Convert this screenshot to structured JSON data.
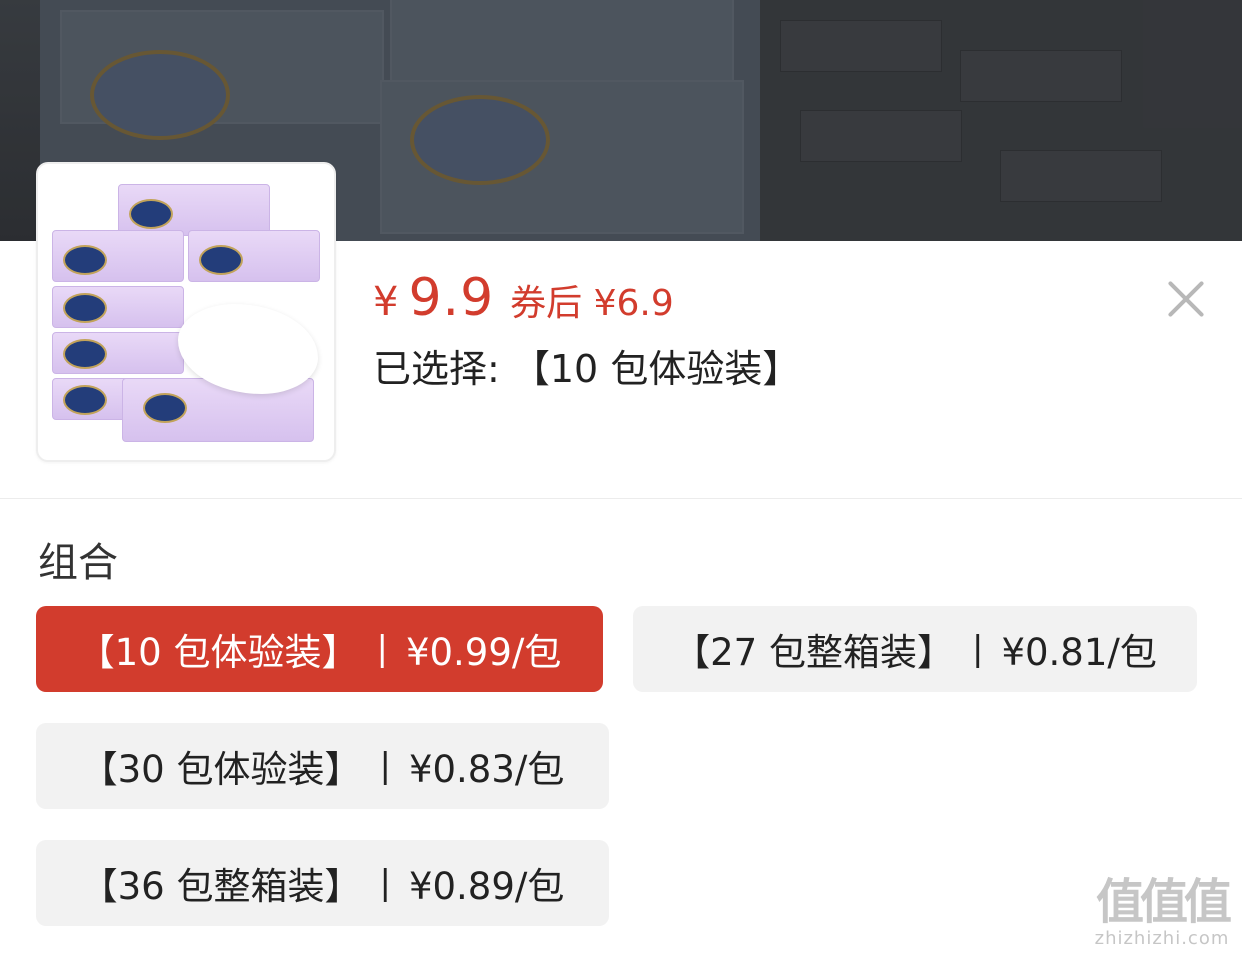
{
  "product": {
    "currency_symbol": "¥",
    "price": "9.9",
    "coupon_text": "券后 ¥6.9",
    "selected_text": "已选择: 【10 包体验装】",
    "thumbnail_icon": "tissue-box-product-image"
  },
  "options_section": {
    "title": "组合",
    "options": [
      {
        "name": "【10 包体验装】",
        "unit_price": "¥0.99/包",
        "selected": true
      },
      {
        "name": "【27 包整箱装】",
        "unit_price": "¥0.81/包",
        "selected": false
      },
      {
        "name": "【30 包体验装】",
        "unit_price": "¥0.83/包",
        "selected": false
      },
      {
        "name": "【36 包整箱装】",
        "unit_price": "¥0.89/包",
        "selected": false
      }
    ],
    "separator": "|"
  },
  "watermark": {
    "mark": "值值值",
    "url": "zhizhizhi.com"
  },
  "colors": {
    "accent": "#d23c2d",
    "option_bg": "#f2f2f2",
    "text": "#222222"
  }
}
